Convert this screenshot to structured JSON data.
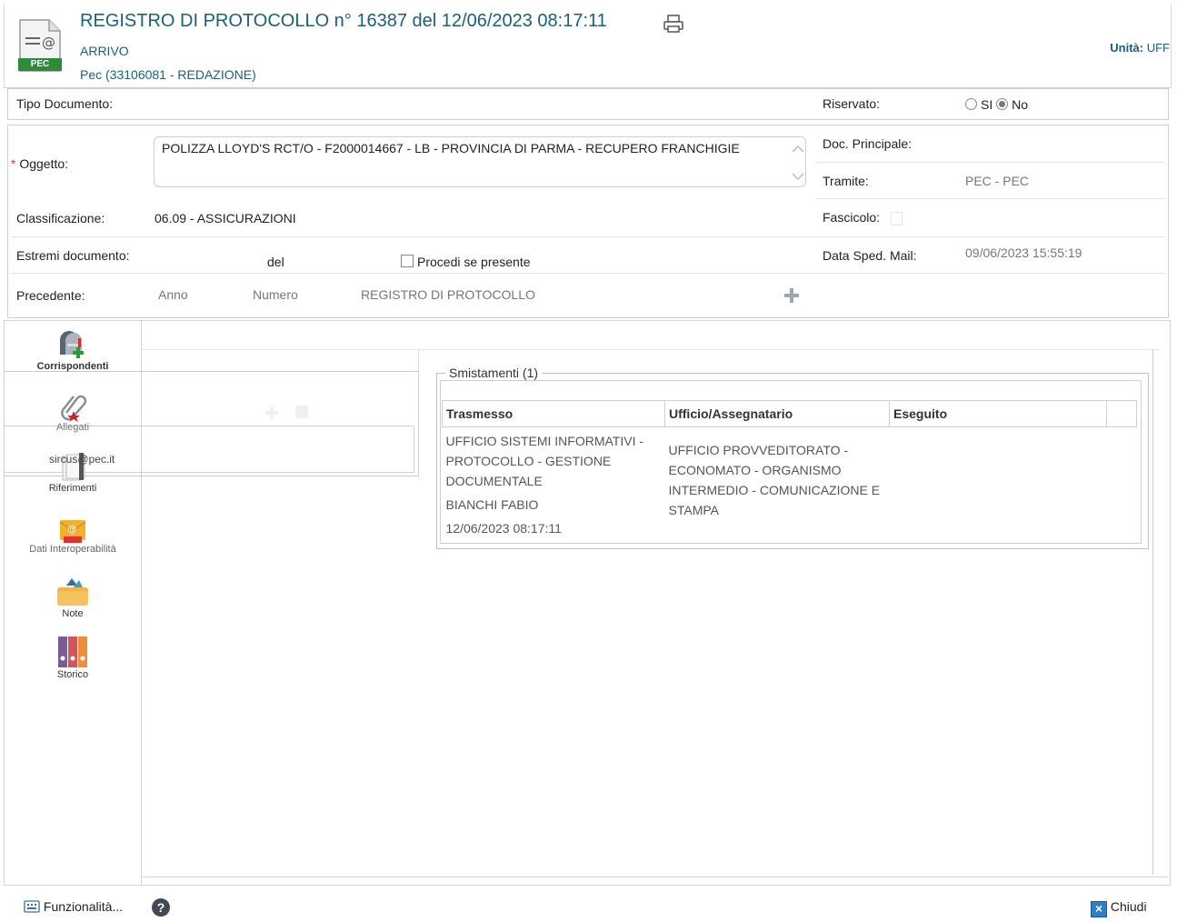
{
  "header": {
    "title": "REGISTRO DI PROTOCOLLO n° 16387 del 12/06/2023 08:17:11",
    "direction": "ARRIVO",
    "source": "Pec (33106081 - REDAZIONE)",
    "doc_icon_label": "PEC",
    "unit_label": "Unità:",
    "unit_value": "UFF"
  },
  "form": {
    "tipo_documento_label": "Tipo Documento:",
    "riservato_label": "Riservato:",
    "riservato_si": "SI",
    "riservato_no": "No",
    "riservato_selected": "No",
    "oggetto_required": "*",
    "oggetto_label": "Oggetto:",
    "oggetto_value": "POLIZZA LLOYD'S RCT/O - F2000014667 - LB - PROVINCIA DI PARMA - RECUPERO FRANCHIGIE",
    "doc_principale_label": "Doc. Principale:",
    "tramite_label": "Tramite:",
    "tramite_value": "PEC - PEC",
    "classificazione_label": "Classificazione:",
    "classificazione_value": "06.09 - ASSICURAZIONI",
    "fascicolo_label": "Fascicolo:",
    "estremi_label": "Estremi documento:",
    "estremi_del": "del",
    "procedi_label": "Procedi se presente",
    "data_sped_label": "Data Sped. Mail:",
    "data_sped_value": "09/06/2023 15:55:19",
    "precedente_label": "Precedente:",
    "anno_placeholder": "Anno",
    "numero_placeholder": "Numero",
    "registro_placeholder": "REGISTRO DI PROTOCOLLO",
    "add_symbol": "+"
  },
  "sidebar": {
    "items": [
      {
        "label": "Corrispondenti",
        "icon": "mailbox-icon"
      },
      {
        "label": "Allegati",
        "icon": "paperclip-icon"
      },
      {
        "label": "Riferimenti",
        "icon": "documents-icon"
      },
      {
        "label": "Dati Interoperabilità",
        "icon": "pec-envelope-icon"
      },
      {
        "label": "Note",
        "icon": "folder-notes-icon"
      },
      {
        "label": "Storico",
        "icon": "binders-icon"
      }
    ],
    "email_overlay": "sircus@pec.it"
  },
  "smistamenti": {
    "legend": "Smistamenti (1)",
    "columns": [
      "Trasmesso",
      "Ufficio/Assegnatario",
      "Eseguito"
    ],
    "rows": [
      {
        "trasmesso_ufficio": "UFFICIO SISTEMI INFORMATIVI - PROTOCOLLO - GESTIONE DOCUMENTALE",
        "trasmesso_persona": "BIANCHI FABIO",
        "trasmesso_data": "12/06/2023 08:17:11",
        "assegnatario": "UFFICIO PROVVEDITORATO - ECONOMATO - ORGANISMO INTERMEDIO - COMUNICAZIONE E STAMPA",
        "eseguito": ""
      }
    ]
  },
  "footer": {
    "funzionalita_label": "Funzionalità...",
    "help_symbol": "?",
    "chiudi_label": "Chiudi",
    "close_symbol": "×"
  },
  "colors": {
    "accent": "#1b5f7a",
    "required": "#e03030",
    "border": "#cfcfcf"
  }
}
